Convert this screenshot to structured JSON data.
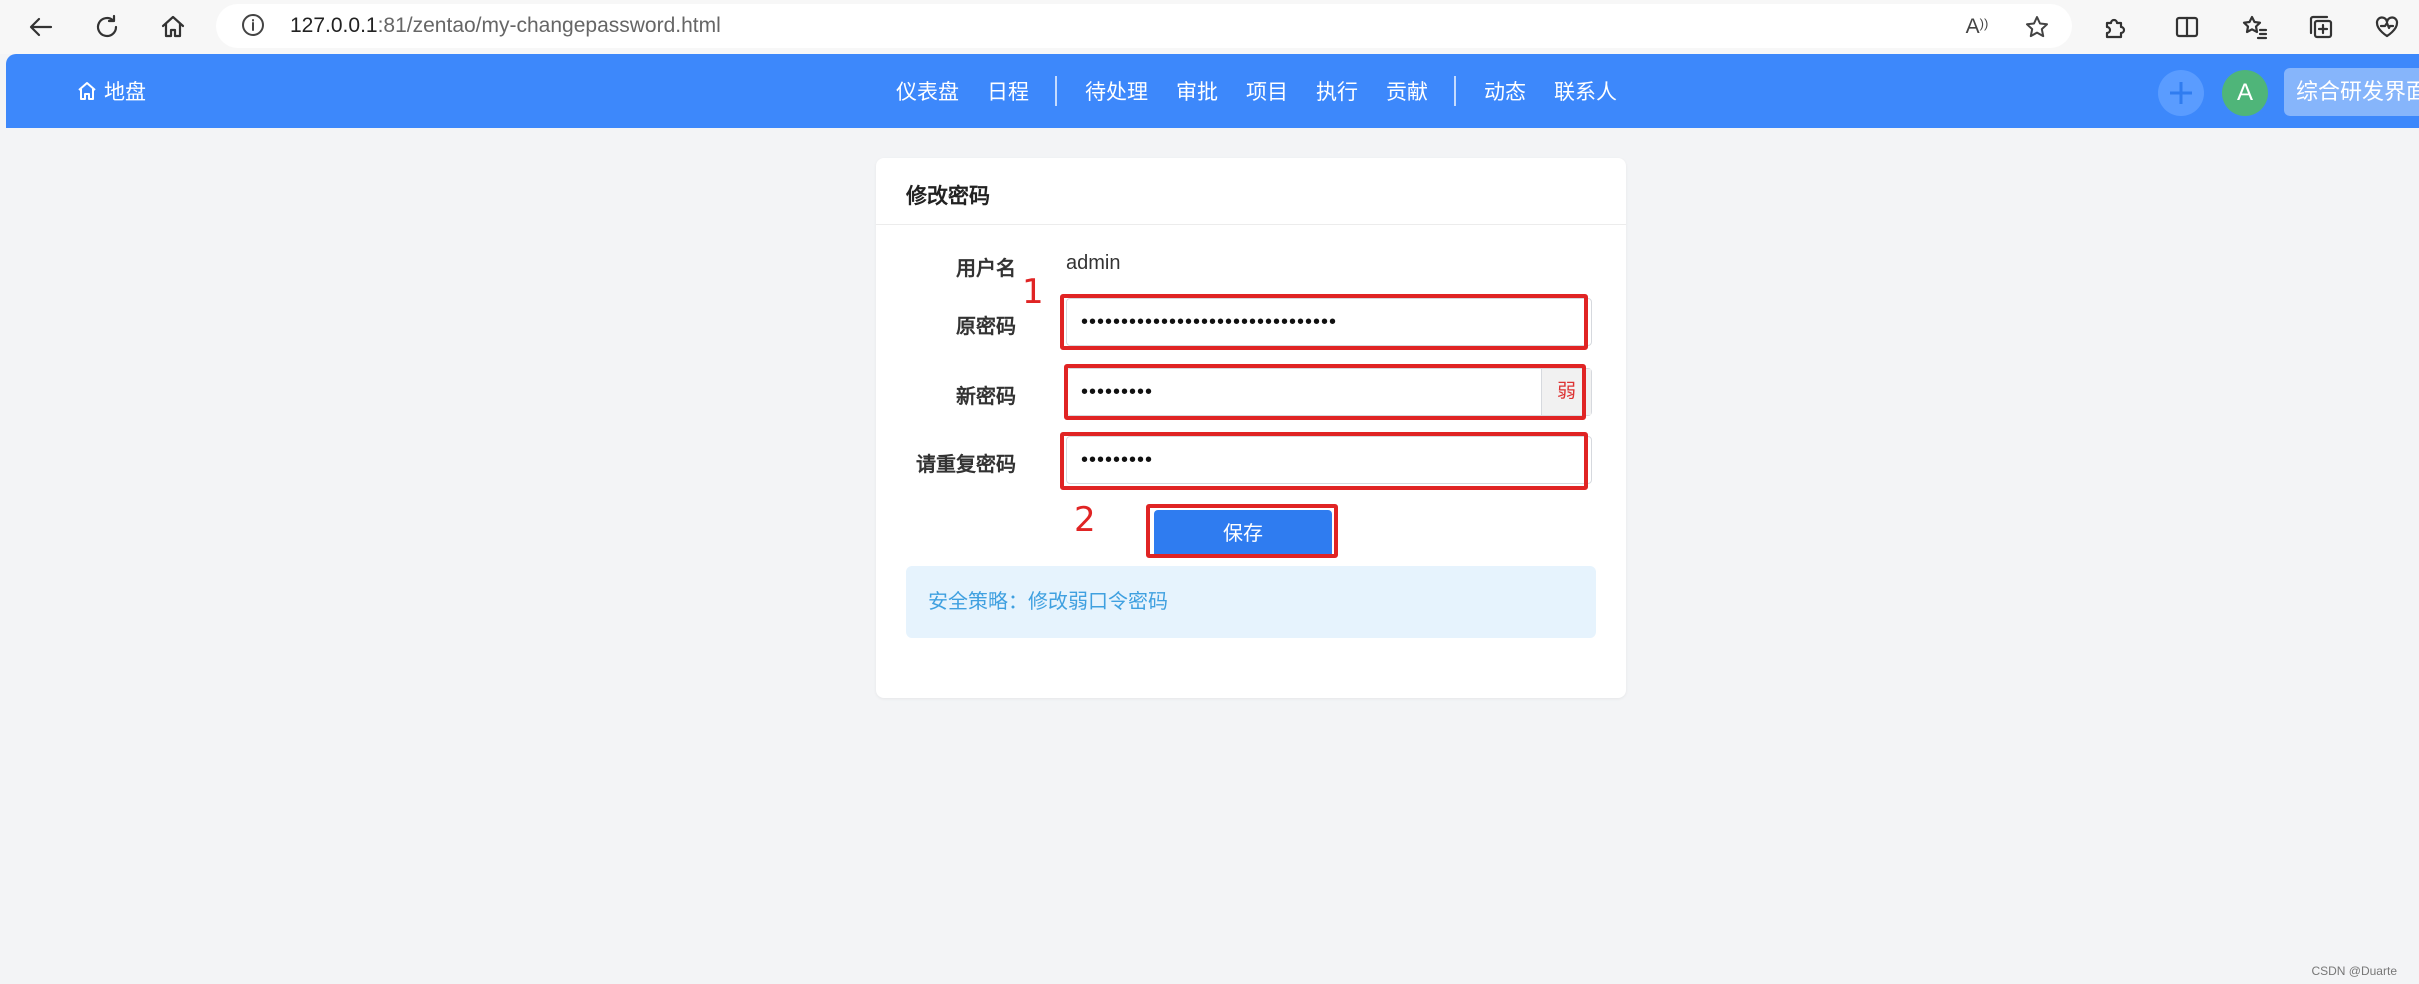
{
  "browser": {
    "url_host": "127.0.0.1",
    "url_rest": ":81/zentao/my-changepassword.html",
    "read_aloud_label": "A"
  },
  "navbar": {
    "brand": "地盘",
    "items": [
      "仪表盘",
      "日程",
      "待处理",
      "审批",
      "项目",
      "执行",
      "贡献",
      "动态",
      "联系人"
    ],
    "avatar_letter": "A",
    "workspace": "综合研发界面"
  },
  "form": {
    "title": "修改密码",
    "username_label": "用户名",
    "username_value": "admin",
    "old_password_label": "原密码",
    "old_password_value": "••••••••••••••••••••••••••••••••",
    "new_password_label": "新密码",
    "new_password_value": "•••••••••",
    "strength_label": "弱",
    "repeat_password_label": "请重复密码",
    "repeat_password_value": "•••••••••",
    "save_label": "保存",
    "notice": "安全策略：修改弱口令密码"
  },
  "annotations": {
    "step1": "1",
    "step2": "2",
    "color": "#e02424"
  },
  "colors": {
    "navbar": "#3d88fb",
    "primary_button": "#2f7cf0",
    "notice_bg": "#e6f3fd",
    "notice_text": "#3fa0e0"
  },
  "watermark": "CSDN @Duarte"
}
